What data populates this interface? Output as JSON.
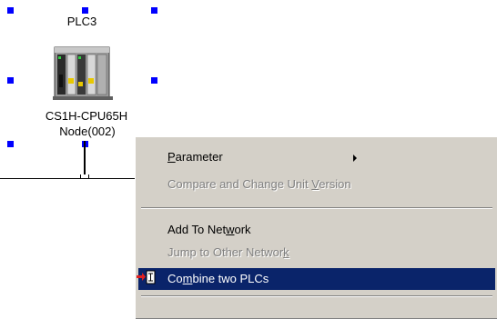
{
  "diagram": {
    "plc_name": "PLC3",
    "plc_model": "CS1H-CPU65H",
    "plc_node": "Node(002)"
  },
  "context_menu": {
    "items": [
      {
        "label": "Parameter",
        "enabled": true,
        "submenu": true
      },
      {
        "label": "Compare and Change Unit Version",
        "enabled": false
      },
      {
        "label": "Add To Network",
        "enabled": true
      },
      {
        "label": "Jump to Other Network",
        "enabled": false
      },
      {
        "label": "Combine two PLCs",
        "enabled": true,
        "selected": true
      }
    ]
  },
  "colors": {
    "selection": "#0a246a",
    "menu_bg": "#d4d0c8",
    "handle": "#0000ff"
  }
}
